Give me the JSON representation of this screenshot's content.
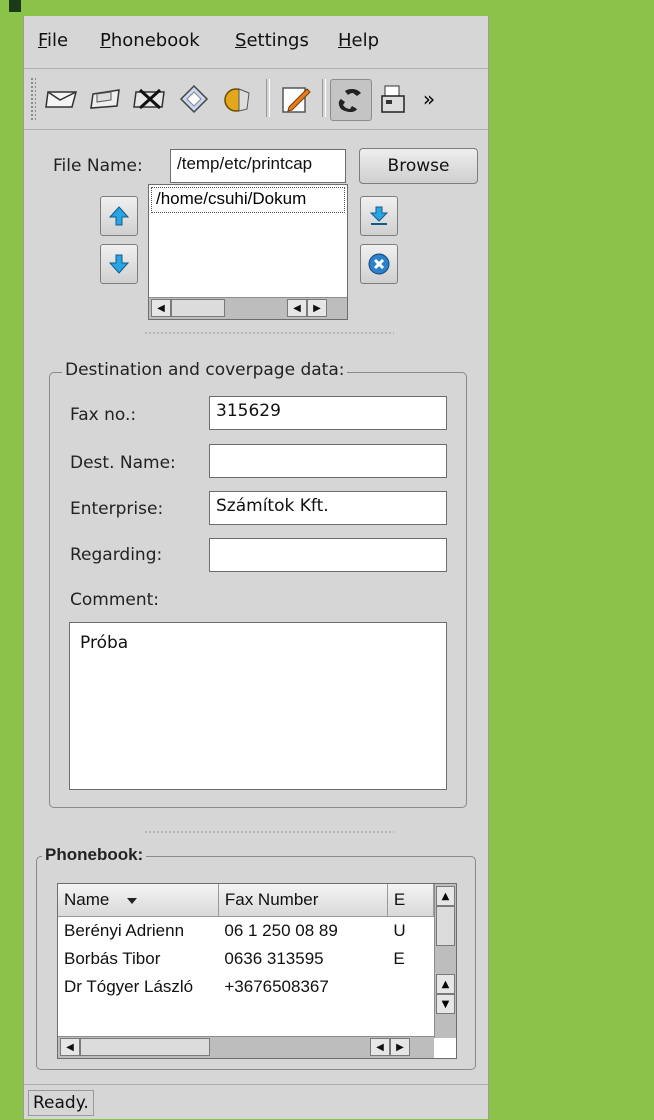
{
  "menu": {
    "file": "File",
    "phonebook": "Phonebook",
    "settings": "Settings",
    "help": "Help"
  },
  "toolbar": {
    "icons": [
      "envelope-icon",
      "envelope-open-icon",
      "envelope-delete-icon",
      "tag-icon",
      "sun-icon",
      "edit-icon",
      "phone-icon",
      "fax-machine-icon"
    ],
    "overflow": "»"
  },
  "file_section": {
    "label": "File Name:",
    "value": "/temp/etc/printcap",
    "browse_label": "Browse",
    "files": [
      "/home/csuhi/Dokum"
    ]
  },
  "destination": {
    "title": "Destination and coverpage data:",
    "fax_label": "Fax no.:",
    "fax_value": "315629",
    "dest_name_label": "Dest. Name:",
    "dest_name_value": "",
    "enterprise_label": "Enterprise:",
    "enterprise_value": "Számítok Kft.",
    "regarding_label": "Regarding:",
    "regarding_value": "",
    "comment_label": "Comment:",
    "comment_value": "Próba"
  },
  "phonebook": {
    "title": "Phonebook:",
    "columns": [
      "Name",
      "Fax Number",
      "E"
    ],
    "rows": [
      [
        "Berényi Adrienn",
        "06 1 250 08 89",
        "U"
      ],
      [
        "Borbás Tibor",
        "0636 313595",
        "E"
      ],
      [
        "Dr Tógyer László",
        "+3676508367",
        ""
      ]
    ]
  },
  "status": {
    "text": "Ready."
  }
}
